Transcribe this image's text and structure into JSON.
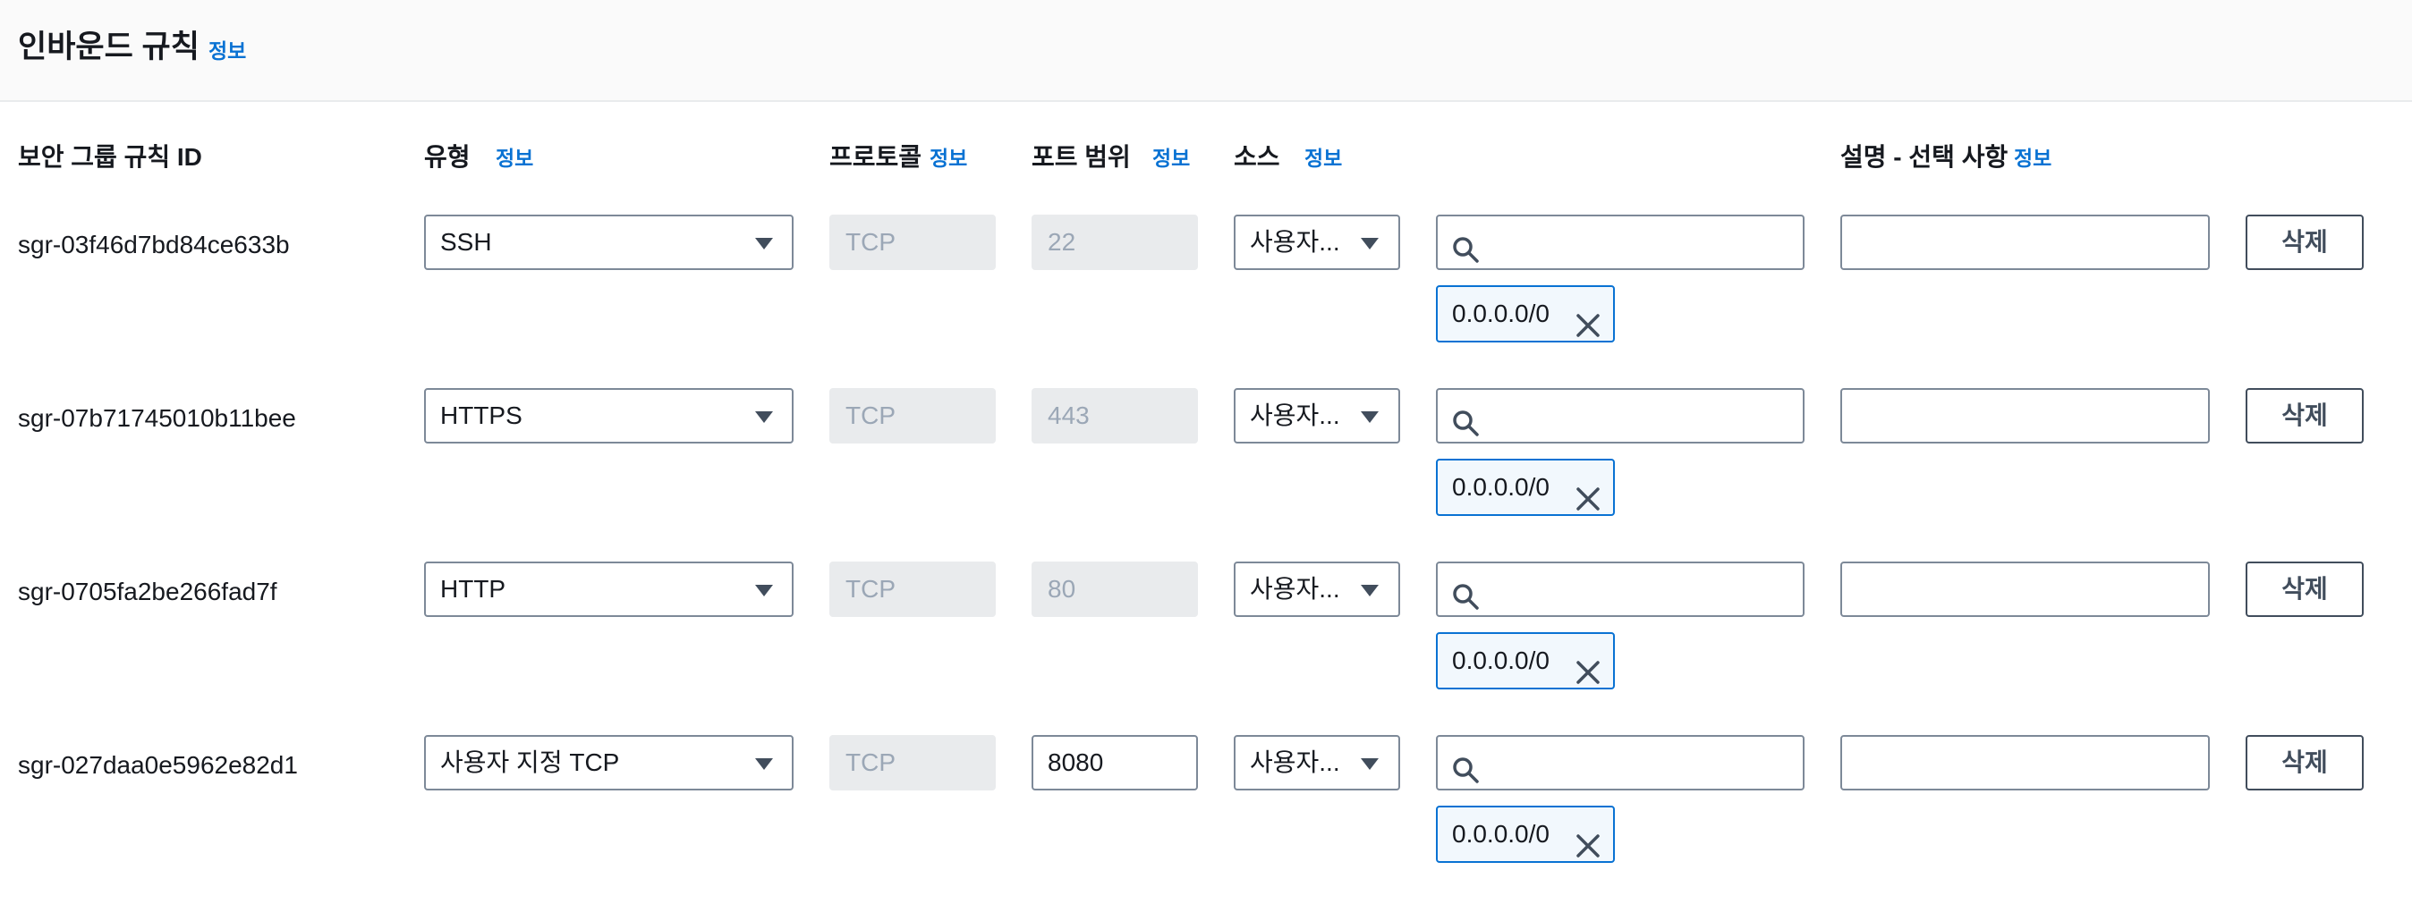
{
  "header": {
    "title": "인바운드 규칙",
    "info": "정보"
  },
  "columns": {
    "rule_id": "보안 그룹 규칙 ID",
    "type": "유형",
    "protocol": "프로토콜",
    "port_range": "포트 범위",
    "source": "소스",
    "description": "설명 - 선택 사항",
    "info": "정보"
  },
  "rules": [
    {
      "id": "sgr-03f46d7bd84ce633b",
      "type": "SSH",
      "protocol": "TCP",
      "port": "22",
      "port_editable": false,
      "source": "사용자...",
      "search_value": "",
      "token": "0.0.0.0/0",
      "description": "",
      "delete_label": "삭제"
    },
    {
      "id": "sgr-07b71745010b11bee",
      "type": "HTTPS",
      "protocol": "TCP",
      "port": "443",
      "port_editable": false,
      "source": "사용자...",
      "search_value": "",
      "token": "0.0.0.0/0",
      "description": "",
      "delete_label": "삭제"
    },
    {
      "id": "sgr-0705fa2be266fad7f",
      "type": "HTTP",
      "protocol": "TCP",
      "port": "80",
      "port_editable": false,
      "source": "사용자...",
      "search_value": "",
      "token": "0.0.0.0/0",
      "description": "",
      "delete_label": "삭제"
    },
    {
      "id": "sgr-027daa0e5962e82d1",
      "type": "사용자 지정 TCP",
      "protocol": "TCP",
      "port": "8080",
      "port_editable": true,
      "source": "사용자...",
      "search_value": "",
      "token": "0.0.0.0/0",
      "description": "",
      "delete_label": "삭제"
    }
  ],
  "icons": {
    "dropdown": "caret-down-icon",
    "search": "search-icon",
    "remove": "close-icon"
  },
  "colors": {
    "link": "#0972d3",
    "token_border": "#0972d3",
    "token_bg": "#f2f8fd",
    "disabled_bg": "#e9ebed",
    "disabled_text": "#9ba7b6"
  }
}
